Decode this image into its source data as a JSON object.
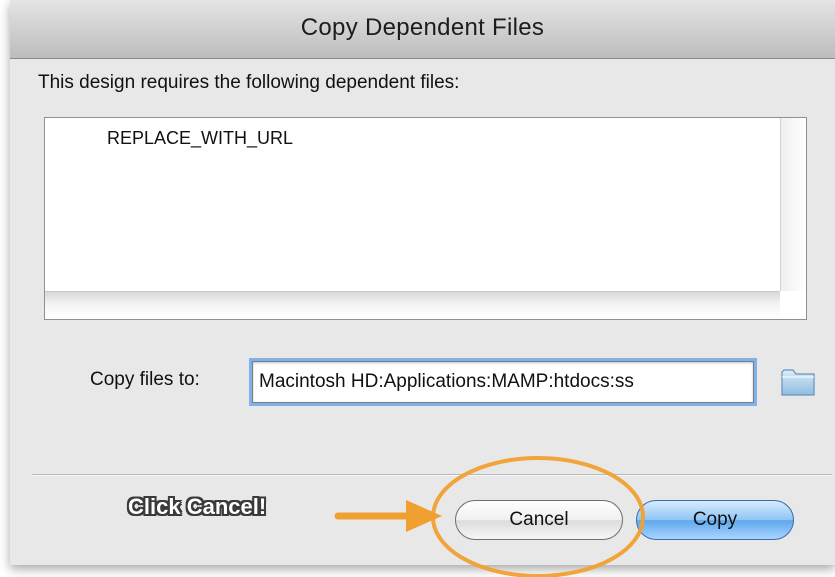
{
  "dialog": {
    "title": "Copy Dependent Files",
    "intro_text": "This design requires the following dependent files:",
    "files": [
      "REPLACE_WITH_URL"
    ],
    "copy_to_label": "Copy files to:",
    "copy_to_value": "Macintosh HD:Applications:MAMP:htdocs:ss",
    "folder_icon": "folder-icon",
    "buttons": {
      "cancel": "Cancel",
      "copy": "Copy"
    }
  },
  "annotation": {
    "text": "Click Cancel!",
    "color": "#f0a030"
  },
  "colors": {
    "accent": "#7fb2ec",
    "default_button": "#5ea6ec",
    "annotation": "#f0a030"
  }
}
